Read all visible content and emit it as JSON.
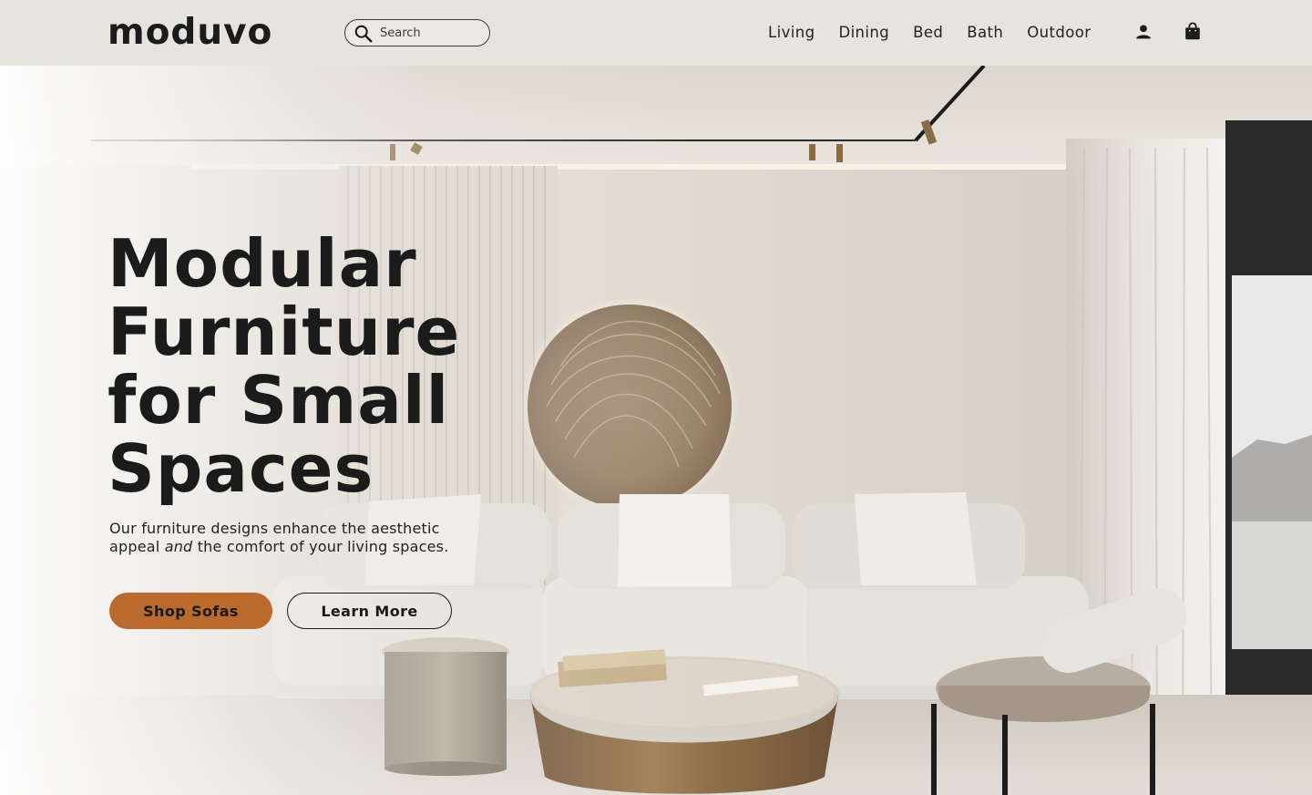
{
  "brand": {
    "logo_text": "moduvo"
  },
  "search": {
    "placeholder": "Search",
    "value": ""
  },
  "nav": {
    "items": [
      {
        "label": "Living"
      },
      {
        "label": "Dining"
      },
      {
        "label": "Bed"
      },
      {
        "label": "Bath"
      },
      {
        "label": "Outdoor"
      }
    ],
    "icons": [
      "account-icon",
      "shopping-bag-icon"
    ]
  },
  "hero": {
    "headline_lines": [
      "Modular",
      "Furniture",
      "for Small",
      "Spaces"
    ],
    "subtext_part1": "Our furniture designs enhance the aesthetic appeal ",
    "subtext_em": "and",
    "subtext_part2": " the comfort of your living spaces.",
    "primary_cta": "Shop Sofas",
    "secondary_cta": "Learn More"
  },
  "colors": {
    "header_bg": "#e7e3de",
    "accent": "#b96a2c",
    "text": "#1b1b1b"
  }
}
